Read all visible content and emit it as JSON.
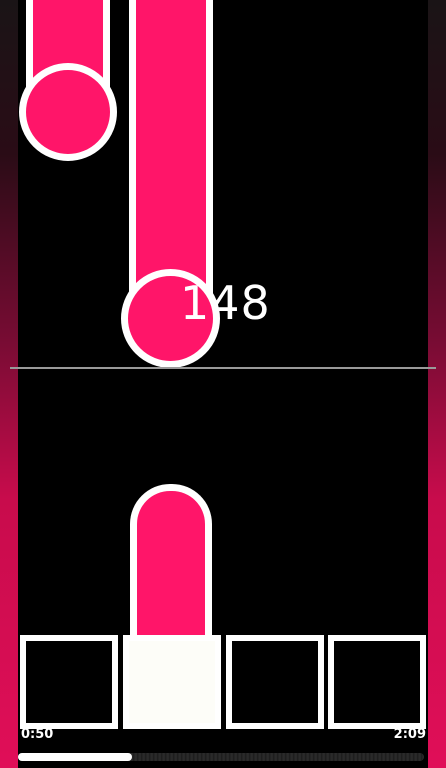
{
  "game": {
    "score": "148",
    "lanes": 4,
    "active_lane": 2,
    "note_color": "#ff1569",
    "outline_color": "#ffffff",
    "side_glow_color": "#e00e58"
  },
  "timer": {
    "elapsed": "0:50",
    "total": "2:09",
    "progress_fraction": 0.28
  }
}
